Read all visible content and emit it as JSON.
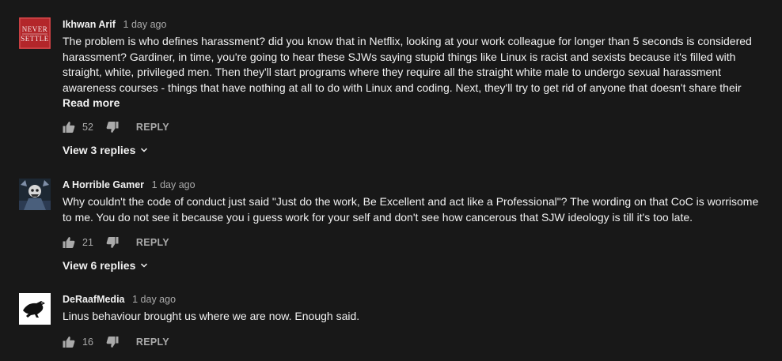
{
  "comments": [
    {
      "author": "Ikhwan Arif",
      "time": "1 day ago",
      "avatar_text": "NEVER SETTLE",
      "text": "The problem is who defines harassment? did you know that in Netflix, looking at your work colleague for longer than 5 seconds is considered harassment? Gardiner, in time, you're going to hear these SJWs saying stupid things like Linux is racist and sexists because it's filled with straight, white, privileged men. Then they'll start programs where they require all the straight white male to undergo sexual harassment awareness courses - things that have nothing at all to do with Linux and coding. Next, they'll try to get rid of anyone that doesn't share their",
      "read_more": "Read more",
      "likes": "52",
      "reply_label": "REPLY",
      "view_replies": "View 3 replies"
    },
    {
      "author": "A Horrible Gamer",
      "time": "1 day ago",
      "text": "Why couldn't the code of conduct just said \"Just do the work, Be Excellent and act like a Professional\"? The wording on that CoC is worrisome to me. You do not see it because you i guess work for your self and don't see how cancerous that SJW ideology is till it's too late.",
      "likes": "21",
      "reply_label": "REPLY",
      "view_replies": "View 6 replies"
    },
    {
      "author": "DeRaafMedia",
      "time": "1 day ago",
      "text": "Linus behaviour brought us where we are now. Enough said.",
      "likes": "16",
      "reply_label": "REPLY"
    }
  ],
  "colors": {
    "background": "#181818",
    "primary_text": "#f1f1f1",
    "secondary_text": "#aaaaaa",
    "avatar_red": "#b3262a"
  },
  "icons": {
    "like": "thumbs-up-icon",
    "dislike": "thumbs-down-icon",
    "expand": "chevron-down-icon"
  }
}
